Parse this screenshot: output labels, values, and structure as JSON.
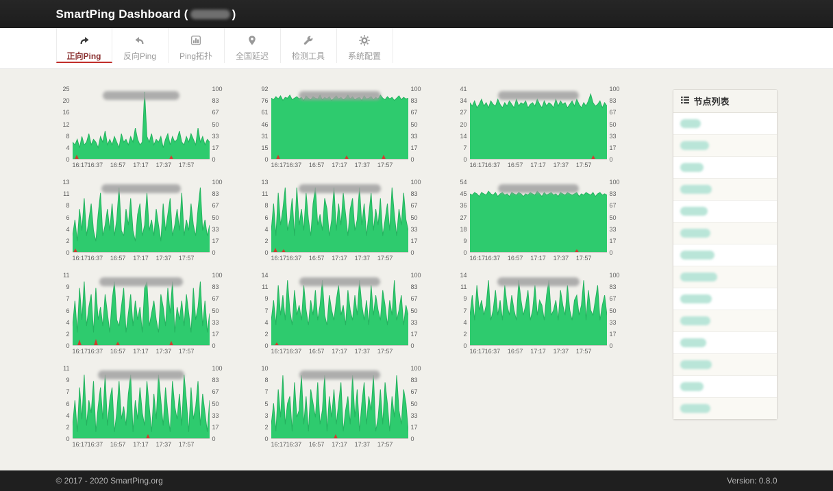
{
  "header": {
    "title_prefix": "SmartPing Dashboard (",
    "title_suffix": ")",
    "title_redacted": true
  },
  "nav": {
    "tabs": [
      {
        "id": "forward-ping",
        "label": "正向Ping",
        "icon": "forward-arrow-icon",
        "active": true
      },
      {
        "id": "reverse-ping",
        "label": "反向Ping",
        "icon": "reverse-arrow-icon",
        "active": false
      },
      {
        "id": "ping-topology",
        "label": "Ping拓扑",
        "icon": "bar-chart-icon",
        "active": false
      },
      {
        "id": "national-latency",
        "label": "全国延迟",
        "icon": "map-pin-icon",
        "active": false
      },
      {
        "id": "detect-tools",
        "label": "检测工具",
        "icon": "wrench-icon",
        "active": false
      },
      {
        "id": "system-config",
        "label": "系统配置",
        "icon": "gear-icon",
        "active": false
      }
    ]
  },
  "colors": {
    "area_green": "#2ecb6e",
    "line_green": "#25b25f",
    "loss_red": "#d43a2f",
    "active_tab_red": "#c12e2a"
  },
  "chart_data": [
    {
      "type": "area",
      "title_redacted": true,
      "title_blob_width": 112,
      "ymax": 25,
      "left_ticks": [
        25,
        20,
        16,
        12,
        8,
        4,
        0
      ],
      "right_ticks": [
        100,
        83,
        67,
        50,
        33,
        17,
        0
      ],
      "x_ticks": [
        "16:17",
        "16:37",
        "16:57",
        "17:17",
        "17:37",
        "17:57"
      ],
      "values": [
        6,
        5,
        7,
        4,
        8,
        5,
        6,
        9,
        5,
        7,
        6,
        4,
        8,
        6,
        10,
        5,
        7,
        5,
        8,
        6,
        4,
        9,
        6,
        7,
        5,
        8,
        6,
        11,
        7,
        5,
        6,
        24,
        8,
        6,
        9,
        5,
        7,
        6,
        8,
        4,
        7,
        9,
        5,
        8,
        6,
        7,
        10,
        6,
        5,
        8,
        6,
        9,
        7,
        5,
        11,
        6,
        8,
        5,
        7,
        6
      ],
      "loss": [
        {
          "x": 0.03,
          "h": 6
        },
        {
          "x": 0.72,
          "h": 5
        }
      ]
    },
    {
      "type": "area",
      "title_redacted": true,
      "title_blob_width": 120,
      "ymax": 92,
      "left_ticks": [
        92,
        76,
        61,
        46,
        31,
        15,
        0
      ],
      "right_ticks": [
        100,
        83,
        67,
        50,
        33,
        17,
        0
      ],
      "x_ticks": [
        "16:17",
        "16:37",
        "16:57",
        "17:17",
        "17:37",
        "17:57"
      ],
      "values": [
        80,
        78,
        82,
        79,
        83,
        77,
        81,
        80,
        84,
        78,
        80,
        82,
        79,
        81,
        77,
        83,
        80,
        78,
        82,
        80,
        79,
        84,
        78,
        81,
        79,
        82,
        77,
        80,
        83,
        79,
        81,
        78,
        80,
        84,
        79,
        82,
        78,
        80,
        81,
        77,
        83,
        79,
        80,
        82,
        78,
        81,
        79,
        84,
        80,
        78,
        82,
        79,
        81,
        77,
        80,
        83,
        78,
        81,
        79,
        80
      ],
      "loss": [
        {
          "x": 0.05,
          "h": 6
        },
        {
          "x": 0.55,
          "h": 5
        },
        {
          "x": 0.82,
          "h": 6
        }
      ]
    },
    {
      "type": "area",
      "title_redacted": true,
      "title_blob_width": 118,
      "ymax": 41,
      "left_ticks": [
        41,
        34,
        27,
        20,
        14,
        7,
        0
      ],
      "right_ticks": [
        100,
        83,
        67,
        50,
        33,
        17,
        0
      ],
      "x_ticks": [
        "16:17",
        "16:37",
        "16:57",
        "17:17",
        "17:37",
        "17:57"
      ],
      "values": [
        33,
        31,
        34,
        30,
        32,
        35,
        31,
        33,
        30,
        34,
        32,
        31,
        35,
        32,
        30,
        33,
        31,
        34,
        32,
        30,
        35,
        31,
        33,
        32,
        34,
        30,
        32,
        33,
        31,
        35,
        32,
        30,
        34,
        31,
        33,
        32,
        30,
        35,
        31,
        34,
        32,
        33,
        30,
        32,
        34,
        31,
        35,
        32,
        30,
        33,
        31,
        34,
        38,
        33,
        31,
        32,
        34,
        30,
        33,
        31
      ],
      "loss": [
        {
          "x": 0.9,
          "h": 5
        }
      ]
    },
    {
      "type": "area",
      "title_redacted": true,
      "title_blob_width": 116,
      "ymax": 13,
      "left_ticks": [
        13,
        11,
        8,
        6,
        4,
        2,
        0
      ],
      "right_ticks": [
        100,
        83,
        67,
        50,
        33,
        17,
        0
      ],
      "x_ticks": [
        "16:17",
        "16:37",
        "16:57",
        "17:17",
        "17:37",
        "17:57"
      ],
      "values": [
        3,
        6,
        2,
        8,
        4,
        10,
        3,
        6,
        9,
        4,
        2,
        7,
        11,
        3,
        5,
        8,
        4,
        9,
        3,
        6,
        12,
        4,
        3,
        8,
        5,
        10,
        4,
        2,
        7,
        9,
        3,
        5,
        11,
        4,
        6,
        3,
        8,
        5,
        2,
        9,
        4,
        7,
        10,
        3,
        5,
        8,
        4,
        11,
        3,
        6,
        4,
        9,
        5,
        3,
        8,
        12,
        4,
        6,
        3,
        5
      ],
      "loss": [
        {
          "x": 0.02,
          "h": 5
        }
      ]
    },
    {
      "type": "area",
      "title_redacted": true,
      "title_blob_width": 120,
      "ymax": 13,
      "left_ticks": [
        13,
        11,
        8,
        6,
        4,
        2,
        0
      ],
      "right_ticks": [
        100,
        83,
        67,
        50,
        33,
        17,
        0
      ],
      "x_ticks": [
        "16:17",
        "16:37",
        "16:57",
        "17:17",
        "17:37",
        "17:57"
      ],
      "values": [
        4,
        9,
        3,
        11,
        5,
        8,
        12,
        4,
        6,
        10,
        3,
        12,
        5,
        8,
        4,
        11,
        6,
        3,
        9,
        12,
        5,
        7,
        4,
        10,
        8,
        3,
        6,
        12,
        4,
        9,
        5,
        11,
        7,
        3,
        8,
        10,
        4,
        6,
        12,
        5,
        9,
        3,
        7,
        11,
        4,
        8,
        5,
        10,
        3,
        6,
        9,
        4,
        12,
        7,
        3,
        8,
        5,
        11,
        6,
        4
      ],
      "loss": [
        {
          "x": 0.03,
          "h": 6
        },
        {
          "x": 0.09,
          "h": 4
        }
      ]
    },
    {
      "type": "area",
      "title_redacted": true,
      "title_blob_width": 118,
      "ymax": 54,
      "left_ticks": [
        54,
        45,
        36,
        27,
        18,
        9,
        0
      ],
      "right_ticks": [
        100,
        83,
        67,
        50,
        33,
        17,
        0
      ],
      "x_ticks": [
        "16:17",
        "16:37",
        "16:57",
        "17:17",
        "17:37",
        "17:57"
      ],
      "values": [
        45,
        44,
        46,
        45,
        43,
        46,
        45,
        44,
        47,
        45,
        44,
        46,
        43,
        45,
        46,
        44,
        45,
        43,
        46,
        45,
        44,
        46,
        45,
        43,
        45,
        44,
        46,
        45,
        44,
        47,
        45,
        43,
        46,
        44,
        45,
        46,
        44,
        45,
        43,
        46,
        45,
        44,
        46,
        45,
        44,
        45,
        46,
        43,
        45,
        44,
        46,
        45,
        44,
        46,
        43,
        45,
        46,
        44,
        45,
        44
      ],
      "loss": [
        {
          "x": 0.78,
          "h": 4
        }
      ]
    },
    {
      "type": "area",
      "title_redacted": true,
      "title_blob_width": 122,
      "ymax": 11,
      "left_ticks": [
        11,
        9,
        7,
        6,
        4,
        2,
        0
      ],
      "right_ticks": [
        100,
        83,
        67,
        50,
        33,
        17,
        0
      ],
      "x_ticks": [
        "16:17",
        "16:37",
        "16:57",
        "17:17",
        "17:37",
        "17:57"
      ],
      "values": [
        3,
        7,
        2,
        9,
        4,
        10,
        3,
        6,
        8,
        2,
        9,
        4,
        6,
        3,
        8,
        5,
        2,
        7,
        10,
        4,
        3,
        6,
        9,
        2,
        5,
        8,
        3,
        7,
        4,
        6,
        2,
        9,
        10,
        3,
        5,
        7,
        4,
        2,
        8,
        6,
        3,
        9,
        5,
        10,
        2,
        6,
        4,
        7,
        3,
        8,
        5,
        2,
        9,
        4,
        6,
        10,
        3,
        7,
        2,
        5
      ],
      "loss": [
        {
          "x": 0.05,
          "h": 8
        },
        {
          "x": 0.17,
          "h": 9
        },
        {
          "x": 0.33,
          "h": 5
        },
        {
          "x": 0.72,
          "h": 6
        }
      ]
    },
    {
      "type": "area",
      "title_redacted": true,
      "title_blob_width": 118,
      "ymax": 14,
      "left_ticks": [
        14,
        11,
        9,
        7,
        4,
        2,
        0
      ],
      "right_ticks": [
        100,
        83,
        67,
        50,
        33,
        17,
        0
      ],
      "x_ticks": [
        "16:17",
        "16:37",
        "16:57",
        "17:17",
        "17:37",
        "17:57"
      ],
      "values": [
        5,
        9,
        4,
        12,
        6,
        10,
        5,
        13,
        7,
        4,
        11,
        6,
        8,
        5,
        12,
        7,
        4,
        9,
        6,
        11,
        5,
        8,
        13,
        6,
        4,
        10,
        7,
        5,
        9,
        12,
        6,
        8,
        4,
        11,
        7,
        5,
        10,
        6,
        13,
        8,
        5,
        9,
        4,
        12,
        6,
        10,
        7,
        5,
        11,
        8,
        4,
        9,
        6,
        13,
        5,
        7,
        10,
        4,
        8,
        6
      ],
      "loss": [
        {
          "x": 0.04,
          "h": 4
        }
      ]
    },
    {
      "type": "area",
      "title_redacted": true,
      "title_blob_width": 120,
      "ymax": 14,
      "left_ticks": [
        14,
        11,
        9,
        7,
        4,
        2,
        0
      ],
      "right_ticks": [
        100,
        83,
        67,
        50,
        33,
        17,
        0
      ],
      "x_ticks": [
        "16:17",
        "16:37",
        "16:57",
        "17:17",
        "17:37",
        "17:57"
      ],
      "values": [
        6,
        10,
        5,
        12,
        7,
        9,
        6,
        8,
        13,
        5,
        7,
        11,
        6,
        9,
        5,
        12,
        8,
        6,
        10,
        7,
        5,
        13,
        9,
        6,
        8,
        11,
        5,
        7,
        12,
        6,
        9,
        8,
        5,
        10,
        13,
        6,
        7,
        9,
        5,
        11,
        8,
        6,
        12,
        7,
        5,
        9,
        10,
        6,
        8,
        13,
        5,
        11,
        7,
        6,
        9,
        12,
        5,
        8,
        10,
        6
      ],
      "loss": []
    },
    {
      "type": "area",
      "title_redacted": true,
      "title_blob_width": 126,
      "ymax": 11,
      "left_ticks": [
        11,
        9,
        7,
        6,
        4,
        2,
        0
      ],
      "right_ticks": [
        100,
        83,
        67,
        50,
        33,
        17,
        0
      ],
      "x_ticks": [
        "16:17",
        "16:37",
        "16:57",
        "17:17",
        "17:37",
        "17:57"
      ],
      "values": [
        2,
        6,
        1,
        8,
        3,
        10,
        2,
        6,
        4,
        9,
        1,
        5,
        8,
        3,
        10,
        2,
        6,
        8,
        1,
        4,
        9,
        3,
        5,
        2,
        7,
        10,
        1,
        6,
        3,
        8,
        4,
        2,
        9,
        5,
        1,
        7,
        3,
        10,
        6,
        2,
        8,
        4,
        1,
        9,
        5,
        3,
        7,
        2,
        10,
        6,
        1,
        8,
        3,
        5,
        9,
        2,
        7,
        4,
        1,
        6
      ],
      "loss": [
        {
          "x": 0.55,
          "h": 6
        }
      ]
    },
    {
      "type": "area",
      "title_redacted": true,
      "title_blob_width": 118,
      "ymax": 10,
      "left_ticks": [
        10,
        8,
        7,
        5,
        3,
        2,
        0
      ],
      "right_ticks": [
        100,
        83,
        67,
        50,
        33,
        17,
        0
      ],
      "x_ticks": [
        "16:17",
        "16:37",
        "16:57",
        "17:17",
        "17:37",
        "17:57"
      ],
      "values": [
        2,
        5,
        1,
        7,
        3,
        9,
        2,
        5,
        6,
        1,
        8,
        3,
        4,
        9,
        2,
        6,
        1,
        7,
        5,
        3,
        8,
        2,
        4,
        9,
        1,
        6,
        3,
        7,
        2,
        5,
        8,
        1,
        4,
        6,
        2,
        9,
        3,
        7,
        1,
        5,
        8,
        2,
        6,
        4,
        9,
        1,
        3,
        7,
        2,
        8,
        5,
        1,
        6,
        3,
        9,
        4,
        2,
        7,
        5,
        1
      ],
      "loss": [
        {
          "x": 0.47,
          "h": 6
        }
      ]
    }
  ],
  "sidebar": {
    "title": "节点列表",
    "items": [
      {
        "redacted": true,
        "blob_width": 30
      },
      {
        "redacted": true,
        "blob_width": 42
      },
      {
        "redacted": true,
        "blob_width": 34
      },
      {
        "redacted": true,
        "blob_width": 46
      },
      {
        "redacted": true,
        "blob_width": 40
      },
      {
        "redacted": true,
        "blob_width": 44
      },
      {
        "redacted": true,
        "blob_width": 50
      },
      {
        "redacted": true,
        "blob_width": 54
      },
      {
        "redacted": true,
        "blob_width": 46
      },
      {
        "redacted": true,
        "blob_width": 44
      },
      {
        "redacted": true,
        "blob_width": 38
      },
      {
        "redacted": true,
        "blob_width": 46
      },
      {
        "redacted": true,
        "blob_width": 34
      },
      {
        "redacted": true,
        "blob_width": 44
      }
    ]
  },
  "footer": {
    "copyright": "© 2017 - 2020 SmartPing.org",
    "version": "Version: 0.8.0"
  }
}
